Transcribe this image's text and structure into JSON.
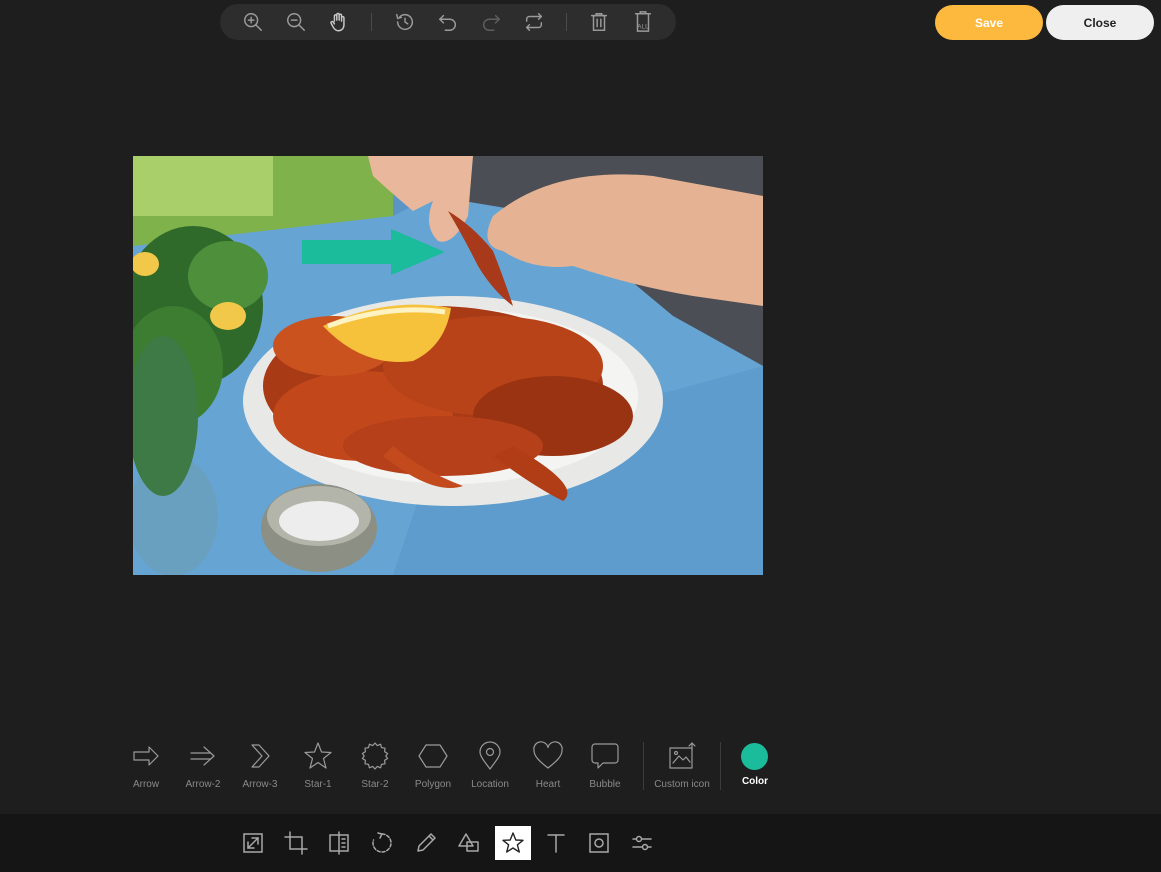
{
  "top_toolbar": {
    "buttons": [
      {
        "id": "zoom-in",
        "icon": "zoom-in-icon"
      },
      {
        "id": "zoom-out",
        "icon": "zoom-out-icon"
      },
      {
        "id": "pan",
        "icon": "hand-icon"
      },
      {
        "id": "history",
        "icon": "history-icon"
      },
      {
        "id": "undo",
        "icon": "undo-icon"
      },
      {
        "id": "redo",
        "icon": "redo-icon"
      },
      {
        "id": "reset",
        "icon": "reset-icon"
      },
      {
        "id": "delete",
        "icon": "trash-icon"
      },
      {
        "id": "delete-all",
        "icon": "trash-all-icon",
        "label": "ALL"
      }
    ]
  },
  "actions": {
    "save_label": "Save",
    "close_label": "Close",
    "save_color": "#fdb83e",
    "close_color": "#efefef"
  },
  "canvas": {
    "image": "photo of cooked crayfish on a white plate with a lemon wedge",
    "annotation": {
      "shape": "arrow",
      "color": "#1abc9c"
    }
  },
  "shapes": {
    "items": [
      {
        "label": "Arrow",
        "icon": "arrow-icon"
      },
      {
        "label": "Arrow-2",
        "icon": "arrow-2-icon"
      },
      {
        "label": "Arrow-3",
        "icon": "arrow-3-icon"
      },
      {
        "label": "Star-1",
        "icon": "star-icon"
      },
      {
        "label": "Star-2",
        "icon": "star-2-icon"
      },
      {
        "label": "Polygon",
        "icon": "polygon-icon"
      },
      {
        "label": "Location",
        "icon": "location-icon"
      },
      {
        "label": "Heart",
        "icon": "heart-icon"
      },
      {
        "label": "Bubble",
        "icon": "bubble-icon"
      }
    ],
    "custom_label": "Custom icon",
    "color_label": "Color",
    "selected_color": "#1abc9c"
  },
  "bottom_tools": [
    {
      "id": "resize",
      "icon": "resize-icon",
      "active": false
    },
    {
      "id": "crop",
      "icon": "crop-icon",
      "active": false
    },
    {
      "id": "flip",
      "icon": "flip-icon",
      "active": false
    },
    {
      "id": "rotate",
      "icon": "rotate-icon",
      "active": false
    },
    {
      "id": "draw",
      "icon": "pencil-icon",
      "active": false
    },
    {
      "id": "shape",
      "icon": "shapes-icon",
      "active": false
    },
    {
      "id": "icon",
      "icon": "star-tool-icon",
      "active": true
    },
    {
      "id": "text",
      "icon": "text-icon",
      "active": false
    },
    {
      "id": "mask",
      "icon": "mask-icon",
      "active": false
    },
    {
      "id": "filter",
      "icon": "sliders-icon",
      "active": false
    }
  ]
}
